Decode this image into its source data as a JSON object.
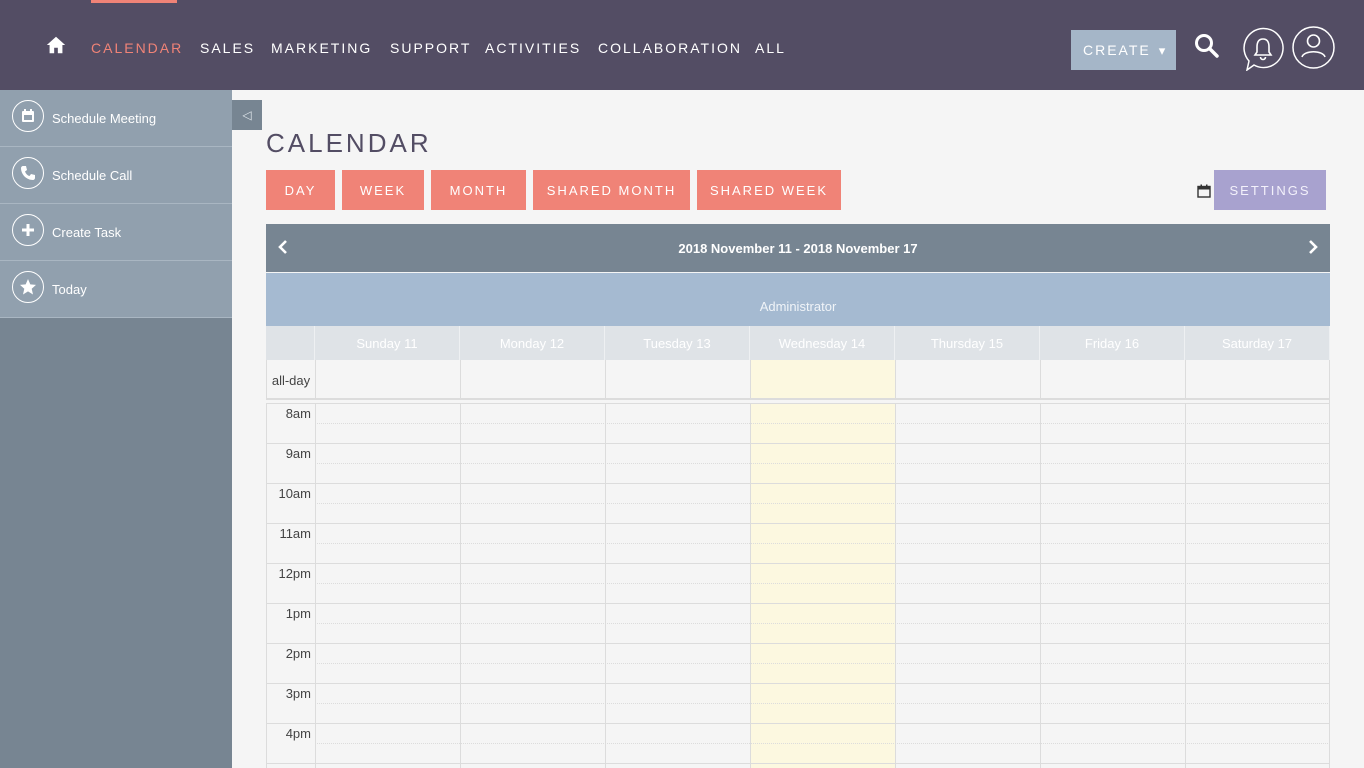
{
  "nav": {
    "items": [
      {
        "label": "CALENDAR",
        "active": true
      },
      {
        "label": "SALES"
      },
      {
        "label": "MARKETING"
      },
      {
        "label": "SUPPORT"
      },
      {
        "label": "ACTIVITIES"
      },
      {
        "label": "COLLABORATION"
      },
      {
        "label": "ALL"
      }
    ],
    "create_label": "CREATE",
    "create_caret": "▾"
  },
  "sidebar": {
    "items": [
      {
        "label": "Schedule Meeting",
        "icon": "calendar-icon"
      },
      {
        "label": "Schedule Call",
        "icon": "phone-icon"
      },
      {
        "label": "Create Task",
        "icon": "plus-icon"
      },
      {
        "label": "Today",
        "icon": "star-icon"
      }
    ],
    "toggle": "◁"
  },
  "page": {
    "title": "CALENDAR",
    "views": [
      "DAY",
      "WEEK",
      "MONTH",
      "SHARED MONTH",
      "SHARED WEEK"
    ],
    "settings_label": "SETTINGS"
  },
  "calendar": {
    "range_label": "2018 November 11 - 2018 November 17",
    "user": "Administrator",
    "days": [
      "Sunday 11",
      "Monday 12",
      "Tuesday 13",
      "Wednesday 14",
      "Thursday 15",
      "Friday 16",
      "Saturday 17"
    ],
    "today_index": 3,
    "allday_label": "all-day",
    "hours": [
      "8am",
      "9am",
      "10am",
      "11am",
      "12pm",
      "1pm",
      "2pm",
      "3pm",
      "4pm"
    ]
  },
  "colors": {
    "topbar": "#534d64",
    "accent": "#f08377",
    "sidebar": "#778592",
    "settings": "#a8a2cf",
    "today": "#fcf8e0"
  }
}
